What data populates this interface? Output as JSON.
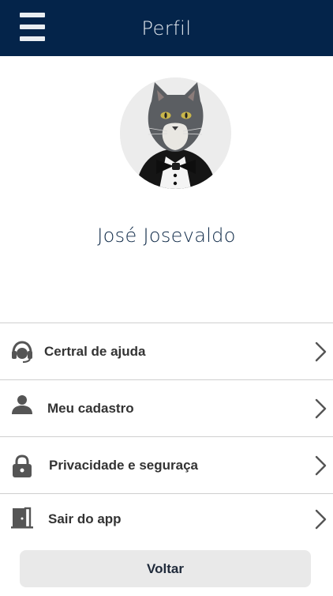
{
  "header": {
    "title": "Perfil",
    "menu_icon": "hamburger-menu-icon",
    "background": "#04244a"
  },
  "profile": {
    "name": "José Josevaldo",
    "avatar_icon": "cat-in-tuxedo-avatar"
  },
  "menu": {
    "items": [
      {
        "label": "Certral de ajuda",
        "icon": "headset-icon"
      },
      {
        "label": "Meu cadastro",
        "icon": "user-icon"
      },
      {
        "label": "Privacidade e seguraça",
        "icon": "lock-icon"
      },
      {
        "label": "Sair do app",
        "icon": "exit-door-icon"
      }
    ],
    "chevron_icon": "chevron-right-icon"
  },
  "footer": {
    "back_label": "Voltar"
  }
}
